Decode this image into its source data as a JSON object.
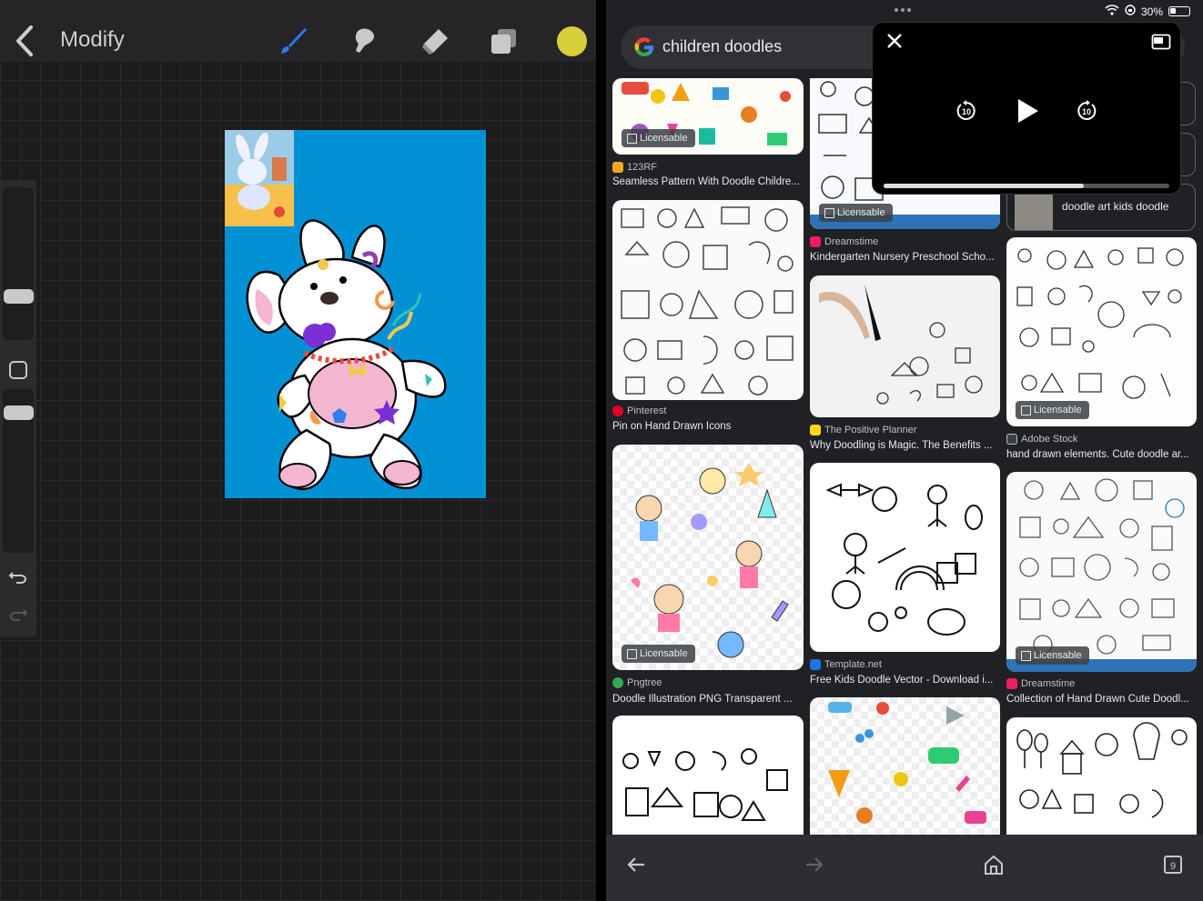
{
  "procreate": {
    "title": "Modify",
    "tools": [
      "brush-icon",
      "smudge-icon",
      "eraser-icon",
      "layers-icon"
    ],
    "color": "#d8cf3a"
  },
  "browser": {
    "status": {
      "battery": "30%"
    },
    "search": {
      "query": "children doodles"
    },
    "results": [
      {
        "source": "123RF",
        "title": "Seamless Pattern With Doodle Childre...",
        "badge": "Licensable",
        "icon_color": "#f5a623"
      },
      {
        "source": "Pinterest",
        "title": "Pin on Hand Drawn Icons",
        "badge": "",
        "icon_color": "#e60023"
      },
      {
        "source": "Pngtree",
        "title": "Doodle Illustration PNG Transparent ...",
        "badge": "Licensable",
        "icon_color": "#34a853"
      },
      {
        "source": "Dreamstime",
        "title": "Kindergarten Nursery Preschool Scho...",
        "badge": "Licensable",
        "icon_color": "#e91e63"
      },
      {
        "source": "The Positive Planner",
        "title": "Why Doodling is Magic. The Benefits ...",
        "badge": "",
        "icon_color": "#f9d71c"
      },
      {
        "source": "Template.net",
        "title": "Free Kids Doodle Vector - Download i...",
        "badge": "",
        "icon_color": "#1a73e8"
      },
      {
        "source": "Adobe Stock",
        "title": "hand drawn elements. Cute doodle ar...",
        "badge": "Licensable",
        "icon_color": "#3c4043"
      },
      {
        "source": "Dreamstime",
        "title": "Collection of Hand Drawn Cute Doodl...",
        "badge": "Licensable",
        "icon_color": "#e91e63"
      }
    ],
    "related_chip": "doodle art kids doodle"
  },
  "player": {
    "skip_back": "10",
    "skip_fwd": "10",
    "progress": 0.7
  }
}
